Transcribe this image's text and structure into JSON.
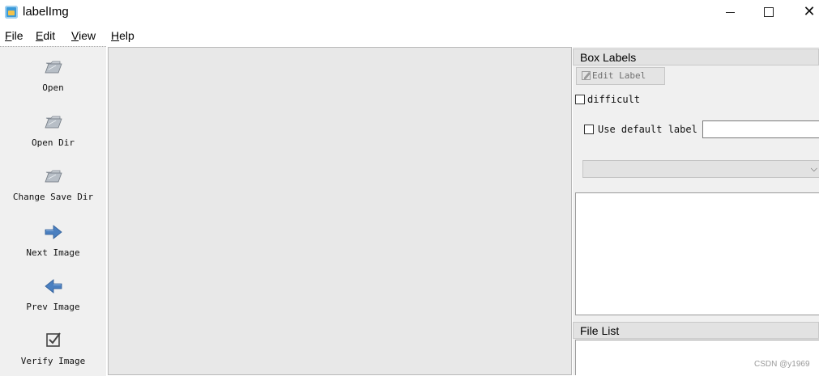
{
  "window": {
    "title": "labelImg",
    "min_icon": "minimize-icon",
    "max_icon": "maximize-icon",
    "close_label": "✕"
  },
  "menu": [
    {
      "key": "F",
      "rest": "ile"
    },
    {
      "key": "E",
      "rest": "dit"
    },
    {
      "key": "V",
      "rest": "iew"
    },
    {
      "key": "H",
      "rest": "elp"
    }
  ],
  "toolbar": {
    "open": {
      "label": "Open",
      "icon": "folder-icon"
    },
    "open_dir": {
      "label": "Open Dir",
      "icon": "folder-icon"
    },
    "change_save_dir": {
      "label": "Change Save Dir",
      "icon": "folder-icon"
    },
    "next_image": {
      "label": "Next Image",
      "icon": "arrow-right-icon"
    },
    "prev_image": {
      "label": "Prev Image",
      "icon": "arrow-left-icon"
    },
    "verify_image": {
      "label": "Verify Image",
      "icon": "checkbox-icon"
    }
  },
  "box_labels": {
    "header": "Box Labels",
    "edit_label": "Edit Label",
    "difficult": "difficult",
    "difficult_checked": false,
    "use_default_label": "Use default label",
    "use_default_checked": false,
    "default_label_value": "",
    "combo_value": ""
  },
  "file_list": {
    "header": "File List"
  },
  "watermark": "CSDN @y1969",
  "colors": {
    "toolbar_bg": "#f0f0f0",
    "canvas_bg": "#e8e8e8",
    "arrow_blue": "#4a7fc0",
    "folder_gray": "#a9b0b8"
  }
}
